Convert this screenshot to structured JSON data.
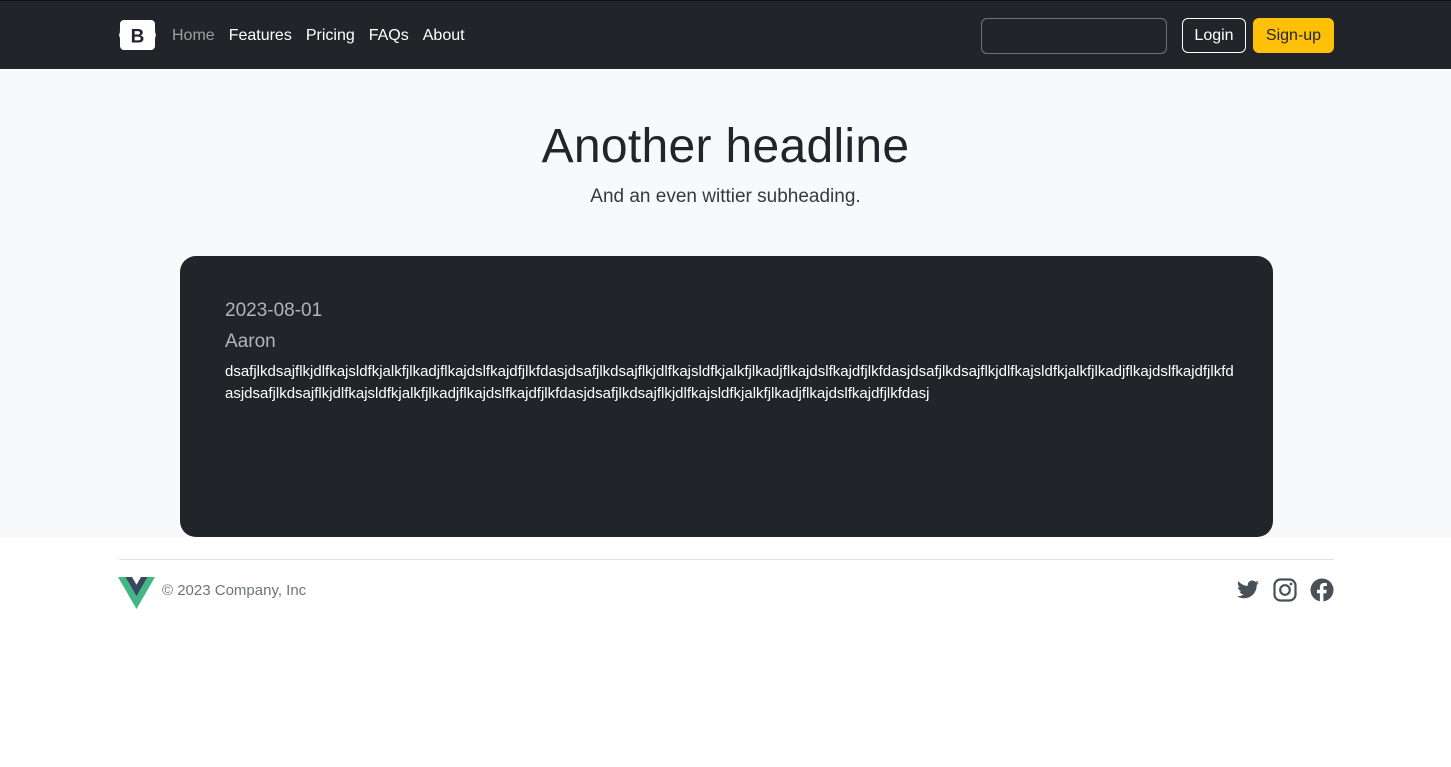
{
  "navbar": {
    "brand_letter": "B",
    "links": [
      {
        "label": "Home",
        "active": true
      },
      {
        "label": "Features",
        "active": false
      },
      {
        "label": "Pricing",
        "active": false
      },
      {
        "label": "FAQs",
        "active": false
      },
      {
        "label": "About",
        "active": false
      }
    ],
    "search": {
      "value": "",
      "placeholder": ""
    },
    "login_label": "Login",
    "signup_label": "Sign-up"
  },
  "hero": {
    "headline": "Another headline",
    "subheading": "And an even wittier subheading."
  },
  "post": {
    "date": "2023-08-01",
    "author": "Aaron",
    "body": "dsafjlkdsajflkjdlfkajsldfkjalkfjlkadjflkajdslfkajdfjlkfdasjdsafjlkdsajflkjdlfkajsldfkjalkfjlkadjflkajdslfkajdfjlkfdasjdsafjlkdsajflkjdlfkajsldfkjalkfjlkadjflkajdslfkajdfjlkfdasjdsafjlkdsajflkjdlfkajsldfkjalkfjlkadjflkajdslfkajdfjlkfdasjdsafjlkdsajflkjdlfkajsldfkjalkfjlkadjflkajdslfkajdfjlkfdasj"
  },
  "footer": {
    "copyright": "© 2023 Company, Inc",
    "social_icons": [
      "twitter-icon",
      "instagram-icon",
      "facebook-icon"
    ]
  },
  "colors": {
    "navbar_bg": "#212529",
    "signup_bg": "#ffc107",
    "hero_bg": "#f8f9fa",
    "card_bg": "#212529",
    "vue_green": "#41b883",
    "vue_dark": "#34495e"
  }
}
